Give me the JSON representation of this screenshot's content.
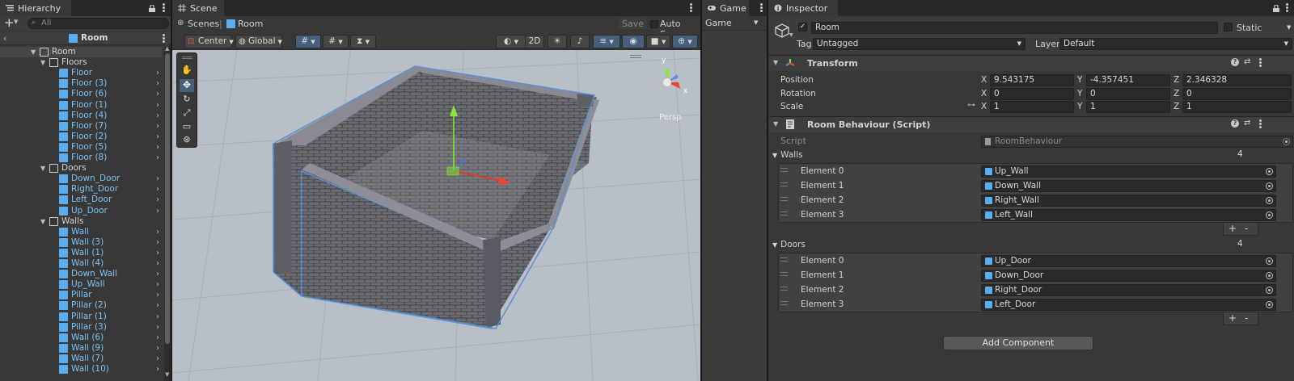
{
  "hierarchy": {
    "tab_label": "Hierarchy",
    "search_placeholder": "All",
    "add_label": "+",
    "scene_title": "Room",
    "items": [
      {
        "label": "Room",
        "depth": 0,
        "expanded": true,
        "prefab": false,
        "chevron": false
      },
      {
        "label": "Floors",
        "depth": 1,
        "expanded": true,
        "prefab": false,
        "chevron": false
      },
      {
        "label": "Floor",
        "depth": 2,
        "prefab": true,
        "chevron": true
      },
      {
        "label": "Floor (3)",
        "depth": 2,
        "prefab": true,
        "chevron": true
      },
      {
        "label": "Floor (6)",
        "depth": 2,
        "prefab": true,
        "chevron": true
      },
      {
        "label": "Floor (1)",
        "depth": 2,
        "prefab": true,
        "chevron": true
      },
      {
        "label": "Floor (4)",
        "depth": 2,
        "prefab": true,
        "chevron": true
      },
      {
        "label": "Floor (7)",
        "depth": 2,
        "prefab": true,
        "chevron": true
      },
      {
        "label": "Floor (2)",
        "depth": 2,
        "prefab": true,
        "chevron": true
      },
      {
        "label": "Floor (5)",
        "depth": 2,
        "prefab": true,
        "chevron": true
      },
      {
        "label": "Floor (8)",
        "depth": 2,
        "prefab": true,
        "chevron": true
      },
      {
        "label": "Doors",
        "depth": 1,
        "expanded": true,
        "prefab": false,
        "chevron": false
      },
      {
        "label": "Down_Door",
        "depth": 2,
        "prefab": true,
        "chevron": true
      },
      {
        "label": "Right_Door",
        "depth": 2,
        "prefab": true,
        "chevron": true
      },
      {
        "label": "Left_Door",
        "depth": 2,
        "prefab": true,
        "chevron": true
      },
      {
        "label": "Up_Door",
        "depth": 2,
        "prefab": true,
        "chevron": true
      },
      {
        "label": "Walls",
        "depth": 1,
        "expanded": true,
        "prefab": false,
        "chevron": false
      },
      {
        "label": "Wall",
        "depth": 2,
        "prefab": true,
        "chevron": true
      },
      {
        "label": "Wall (3)",
        "depth": 2,
        "prefab": true,
        "chevron": true
      },
      {
        "label": "Wall (1)",
        "depth": 2,
        "prefab": true,
        "chevron": true
      },
      {
        "label": "Wall (4)",
        "depth": 2,
        "prefab": true,
        "chevron": true
      },
      {
        "label": "Down_Wall",
        "depth": 2,
        "prefab": true,
        "chevron": true
      },
      {
        "label": "Up_Wall",
        "depth": 2,
        "prefab": true,
        "chevron": true
      },
      {
        "label": "Pillar",
        "depth": 2,
        "prefab": true,
        "chevron": true
      },
      {
        "label": "Pillar (2)",
        "depth": 2,
        "prefab": true,
        "chevron": true
      },
      {
        "label": "Pillar (1)",
        "depth": 2,
        "prefab": true,
        "chevron": true
      },
      {
        "label": "Pillar (3)",
        "depth": 2,
        "prefab": true,
        "chevron": true
      },
      {
        "label": "Wall (6)",
        "depth": 2,
        "prefab": true,
        "chevron": true
      },
      {
        "label": "Wall (9)",
        "depth": 2,
        "prefab": true,
        "chevron": true
      },
      {
        "label": "Wall (7)",
        "depth": 2,
        "prefab": true,
        "chevron": true
      },
      {
        "label": "Wall (10)",
        "depth": 2,
        "prefab": true,
        "chevron": true
      }
    ]
  },
  "scene": {
    "tab_label": "Scene",
    "breadcrumb_root": "Scenes",
    "breadcrumb_sep": "|",
    "breadcrumb_current": "Room",
    "save_label": "Save",
    "autosave_label": "Auto Save",
    "pivot_label": "Center",
    "space_label": "Global",
    "mode_2d_label": "2D",
    "gizmo_persp_label": "Persp",
    "gizmo_y": "y",
    "gizmo_x": "x"
  },
  "game": {
    "tab_label": "Game",
    "display_label": "Game"
  },
  "inspector": {
    "tab_label": "Inspector",
    "object_name": "Room",
    "static_label": "Static",
    "tag_label": "Tag",
    "tag_value": "Untagged",
    "layer_label": "Layer",
    "layer_value": "Default",
    "transform": {
      "title": "Transform",
      "position_label": "Position",
      "rotation_label": "Rotation",
      "scale_label": "Scale",
      "x": "X",
      "y": "Y",
      "z": "Z",
      "position": [
        "9.543175",
        "-4.357451",
        "2.346328"
      ],
      "rotation": [
        "0",
        "0",
        "0"
      ],
      "scale": [
        "1",
        "1",
        "1"
      ]
    },
    "room_behaviour": {
      "title": "Room Behaviour (Script)",
      "script_label": "Script",
      "script_value": "RoomBehaviour",
      "walls_label": "Walls",
      "walls_count": "4",
      "walls": [
        {
          "label": "Element 0",
          "value": "Up_Wall"
        },
        {
          "label": "Element 1",
          "value": "Down_Wall"
        },
        {
          "label": "Element 2",
          "value": "Right_Wall"
        },
        {
          "label": "Element 3",
          "value": "Left_Wall"
        }
      ],
      "doors_label": "Doors",
      "doors_count": "4",
      "doors": [
        {
          "label": "Element 0",
          "value": "Up_Door"
        },
        {
          "label": "Element 1",
          "value": "Down_Door"
        },
        {
          "label": "Element 2",
          "value": "Right_Door"
        },
        {
          "label": "Element 3",
          "value": "Left_Door"
        }
      ],
      "plus": "+",
      "minus": "-"
    },
    "add_component_label": "Add Component"
  },
  "colors": {
    "accent": "#7cc3f5",
    "selection": "#46607c",
    "panel": "#383838"
  }
}
